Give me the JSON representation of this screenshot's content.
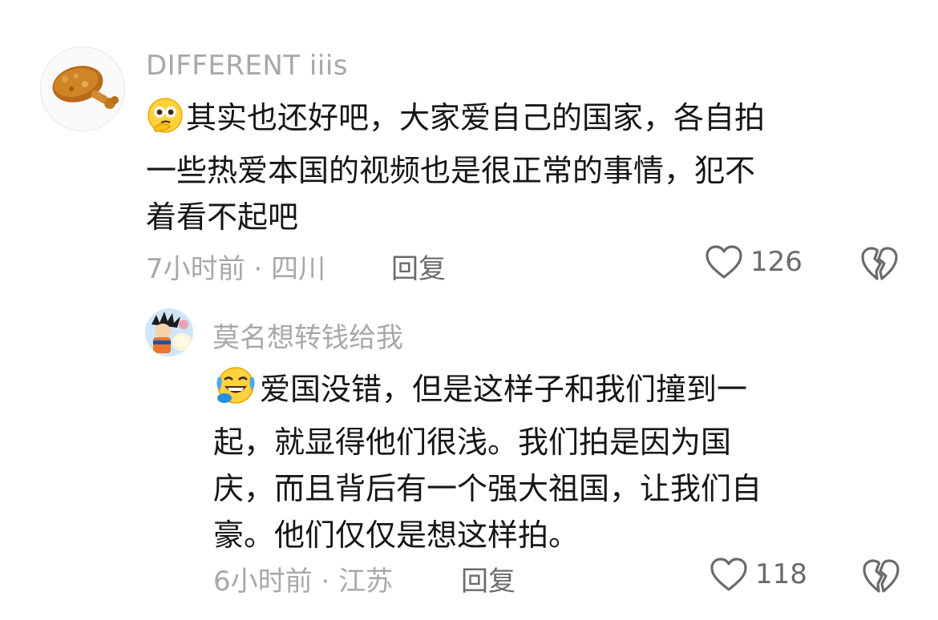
{
  "comments": [
    {
      "author": "DIFFERENT iiis",
      "text_lines": [
        "其实也还好吧，大家爱自己的国家，各自拍",
        "一些热爱本国的视频也是很正常的事情，犯不",
        "着看不起吧"
      ],
      "emoji": "thinking-face",
      "time": "7小时前",
      "location": "四川",
      "reply_label": "回复",
      "likes": "126"
    },
    {
      "author": "莫名想转钱给我",
      "text_lines": [
        "爱国没错，但是这样子和我们撞到一",
        "起，就显得他们很浅。我们拍是因为国",
        "庆，而且背后有一个强大祖国，让我们自",
        "豪。他们仅仅是想这样拍。"
      ],
      "emoji": "rolling-laughing-face",
      "time": "6小时前",
      "location": "江苏",
      "reply_label": "回复",
      "likes": "118"
    }
  ],
  "separator": "·",
  "colors": {
    "text": "#161616",
    "muted": "#a8a8a8",
    "action": "#6b6b6b"
  }
}
